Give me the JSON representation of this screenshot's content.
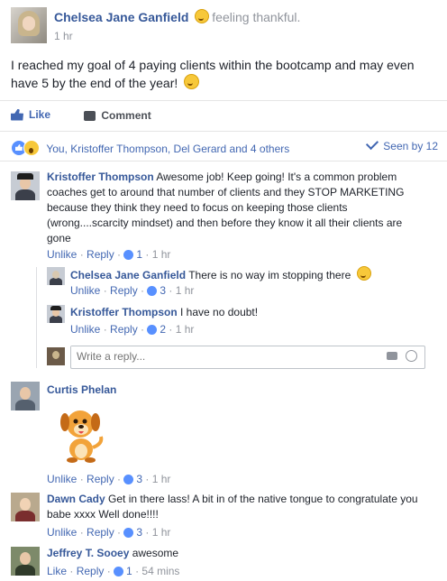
{
  "post": {
    "author": "Chelsea Jane Ganfield",
    "feeling": "feeling thankful.",
    "time": "1 hr",
    "text": "I reached my goal of 4 paying clients within the bootcamp and may even have 5 by the end of the year!"
  },
  "actions": {
    "like": "Like",
    "comment": "Comment"
  },
  "reactions": {
    "summary": "You, Kristoffer Thompson, Del Gerard and 4 others",
    "seen": "Seen by 12"
  },
  "comments": [
    {
      "author": "Kristoffer Thompson",
      "text": "Awesome job! Keep going! It's a common problem coaches get to around that number of clients and they STOP MARKETING because they think they need to focus on keeping those clients (wrong....scarcity mindset) and then before they know it all their clients are gone",
      "action": "Unlike",
      "reply": "Reply",
      "likes": "1",
      "time": "1 hr",
      "replies": [
        {
          "author": "Chelsea Jane Ganfield",
          "text": "There is no way im stopping there",
          "action": "Unlike",
          "reply": "Reply",
          "likes": "3",
          "time": "1 hr"
        },
        {
          "author": "Kristoffer Thompson",
          "text": "I have no doubt!",
          "action": "Unlike",
          "reply": "Reply",
          "likes": "2",
          "time": "1 hr"
        }
      ],
      "reply_placeholder": "Write a reply..."
    },
    {
      "author": "Curtis Phelan",
      "text": "",
      "action": "Unlike",
      "reply": "Reply",
      "likes": "3",
      "time": "1 hr",
      "sticker": "dog-sticker"
    },
    {
      "author": "Dawn Cady",
      "text": "Get in there lass! A bit in of the native tongue to congratulate you babe xxxx Well done!!!!",
      "action": "Unlike",
      "reply": "Reply",
      "likes": "3",
      "time": "1 hr"
    },
    {
      "author": "Jeffrey T. Sooey",
      "text": "awesome",
      "action": "Like",
      "reply": "Reply",
      "likes": "1",
      "time": "54 mins"
    }
  ],
  "colors": {
    "link": "#365899",
    "action": "#4267b2",
    "meta": "#90949c"
  },
  "sep": " · "
}
